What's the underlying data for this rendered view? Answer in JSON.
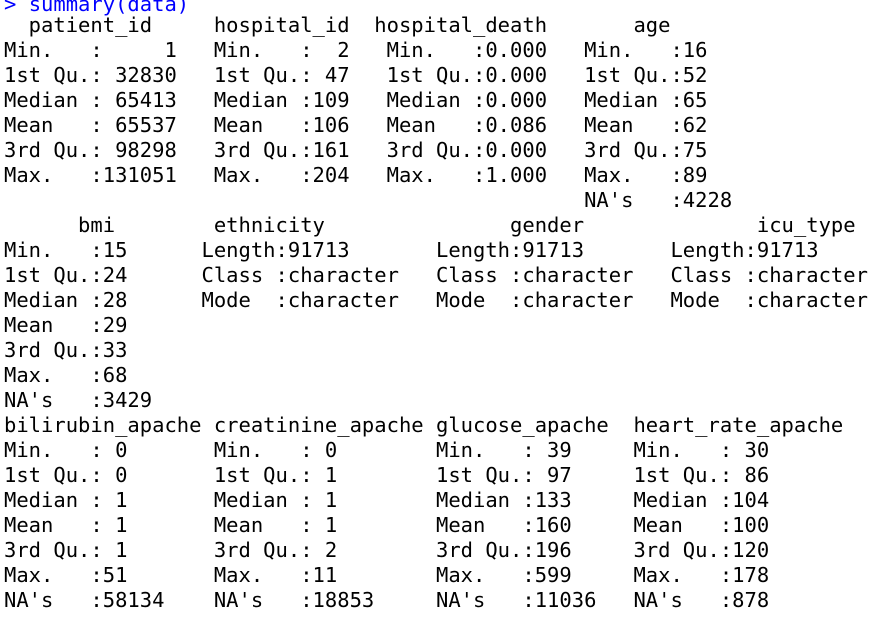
{
  "console": {
    "prompt": ">",
    "command": "summary(data)",
    "output_lines": [
      "  patient_id     hospital_id  hospital_death       age",
      "Min.   :     1   Min.   :  2   Min.   :0.000   Min.   :16",
      "1st Qu.: 32830   1st Qu.: 47   1st Qu.:0.000   1st Qu.:52",
      "Median : 65413   Median :109   Median :0.000   Median :65",
      "Mean   : 65537   Mean   :106   Mean   :0.086   Mean   :62",
      "3rd Qu.: 98298   3rd Qu.:161   3rd Qu.:0.000   3rd Qu.:75",
      "Max.   :131051   Max.   :204   Max.   :1.000   Max.   :89",
      "                                               NA's   :4228",
      "      bmi        ethnicity               gender              icu_type",
      "Min.   :15      Length:91713       Length:91713       Length:91713",
      "1st Qu.:24      Class :character   Class :character   Class :character",
      "Median :28      Mode  :character   Mode  :character   Mode  :character",
      "Mean   :29",
      "3rd Qu.:33",
      "Max.   :68",
      "NA's   :3429",
      "bilirubin_apache creatinine_apache glucose_apache  heart_rate_apache",
      "Min.   : 0       Min.   : 0        Min.   : 39     Min.   : 30",
      "1st Qu.: 0       1st Qu.: 1        1st Qu.: 97     1st Qu.: 86",
      "Median : 1       Median : 1        Median :133     Median :104",
      "Mean   : 1       Mean   : 1        Mean   :160     Mean   :100",
      "3rd Qu.: 1       3rd Qu.: 2        3rd Qu.:196     3rd Qu.:120",
      "Max.   :51       Max.   :11        Max.   :599     Max.   :178",
      "NA's   :58134    NA's   :18853     NA's   :11036   NA's   :878"
    ]
  }
}
